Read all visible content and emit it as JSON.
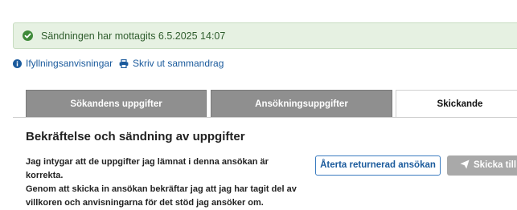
{
  "alert": {
    "icon": "check-circle-icon",
    "message": "Sändningen har mottagits 6.5.2025 14:07",
    "color": "#e6f1e2"
  },
  "links": {
    "instructions": {
      "icon": "info-icon",
      "label": "Ifyllningsanvisningar"
    },
    "print": {
      "icon": "print-icon",
      "label": "Skriv ut sammandrag"
    }
  },
  "tabs": [
    {
      "label": "Sökandens uppgifter",
      "state": "inactive"
    },
    {
      "label": "Ansökningsuppgifter",
      "state": "inactive"
    },
    {
      "label": "Skickande",
      "state": "active"
    }
  ],
  "panel": {
    "title": "Bekräftelse och sändning av uppgifter",
    "paragraph1": "Jag intygar att de uppgifter jag lämnat i denna ansökan är korrekta.",
    "paragraph2": "Genom att skicka in ansökan bekräftar jag att jag har tagit del av villkoren och anvisningarna för det stöd jag ansöker om."
  },
  "buttons": {
    "return_label": "Återta returnerad ansökan",
    "send_label": "Skicka till ha",
    "send_icon": "paper-plane-icon"
  },
  "colors": {
    "link": "#1a5a9c",
    "success": "#3f8a3a",
    "tab_inactive": "#8f8f8f"
  }
}
